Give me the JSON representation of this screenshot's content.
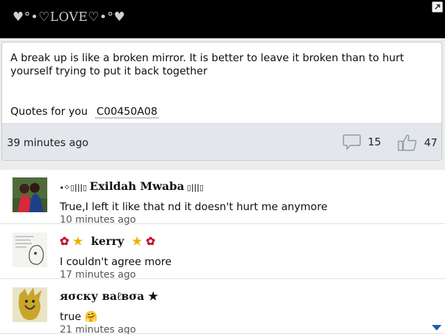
{
  "app": {
    "title": "♥°•♡LOVE♡•°♥"
  },
  "post": {
    "text": "A break up is like a broken mirror. It is better to leave it broken than to hurt yourself trying to put it back together",
    "quote_label": "Quotes for you",
    "quote_code": "C00450A08",
    "time_ago": "39 minutes ago",
    "comment_count": "15",
    "like_count": "47"
  },
  "comments": [
    {
      "name": "Exildah Mwaba",
      "text": "True,I left it like that nd it doesn't hurt me anymore",
      "time": "10 minutes ago",
      "avatar": "photo-avatar"
    },
    {
      "name": "kerry",
      "text": "I couldn't agree more",
      "time": "17 minutes ago",
      "avatar": "sketch-avatar"
    },
    {
      "name": "яσcку вaℓвσa ★",
      "text": "true",
      "time": "21 minutes ago",
      "avatar": "cartoon-avatar"
    }
  ],
  "icons": {
    "expand": "expand-icon",
    "comment": "comment-bubble-icon",
    "like": "thumbs-up-icon",
    "scroll": "scroll-down-icon"
  },
  "colors": {
    "header_bg": "#000000",
    "footer_bg": "#e3e6ea",
    "scroll_indicator": "#1e5fa8"
  }
}
